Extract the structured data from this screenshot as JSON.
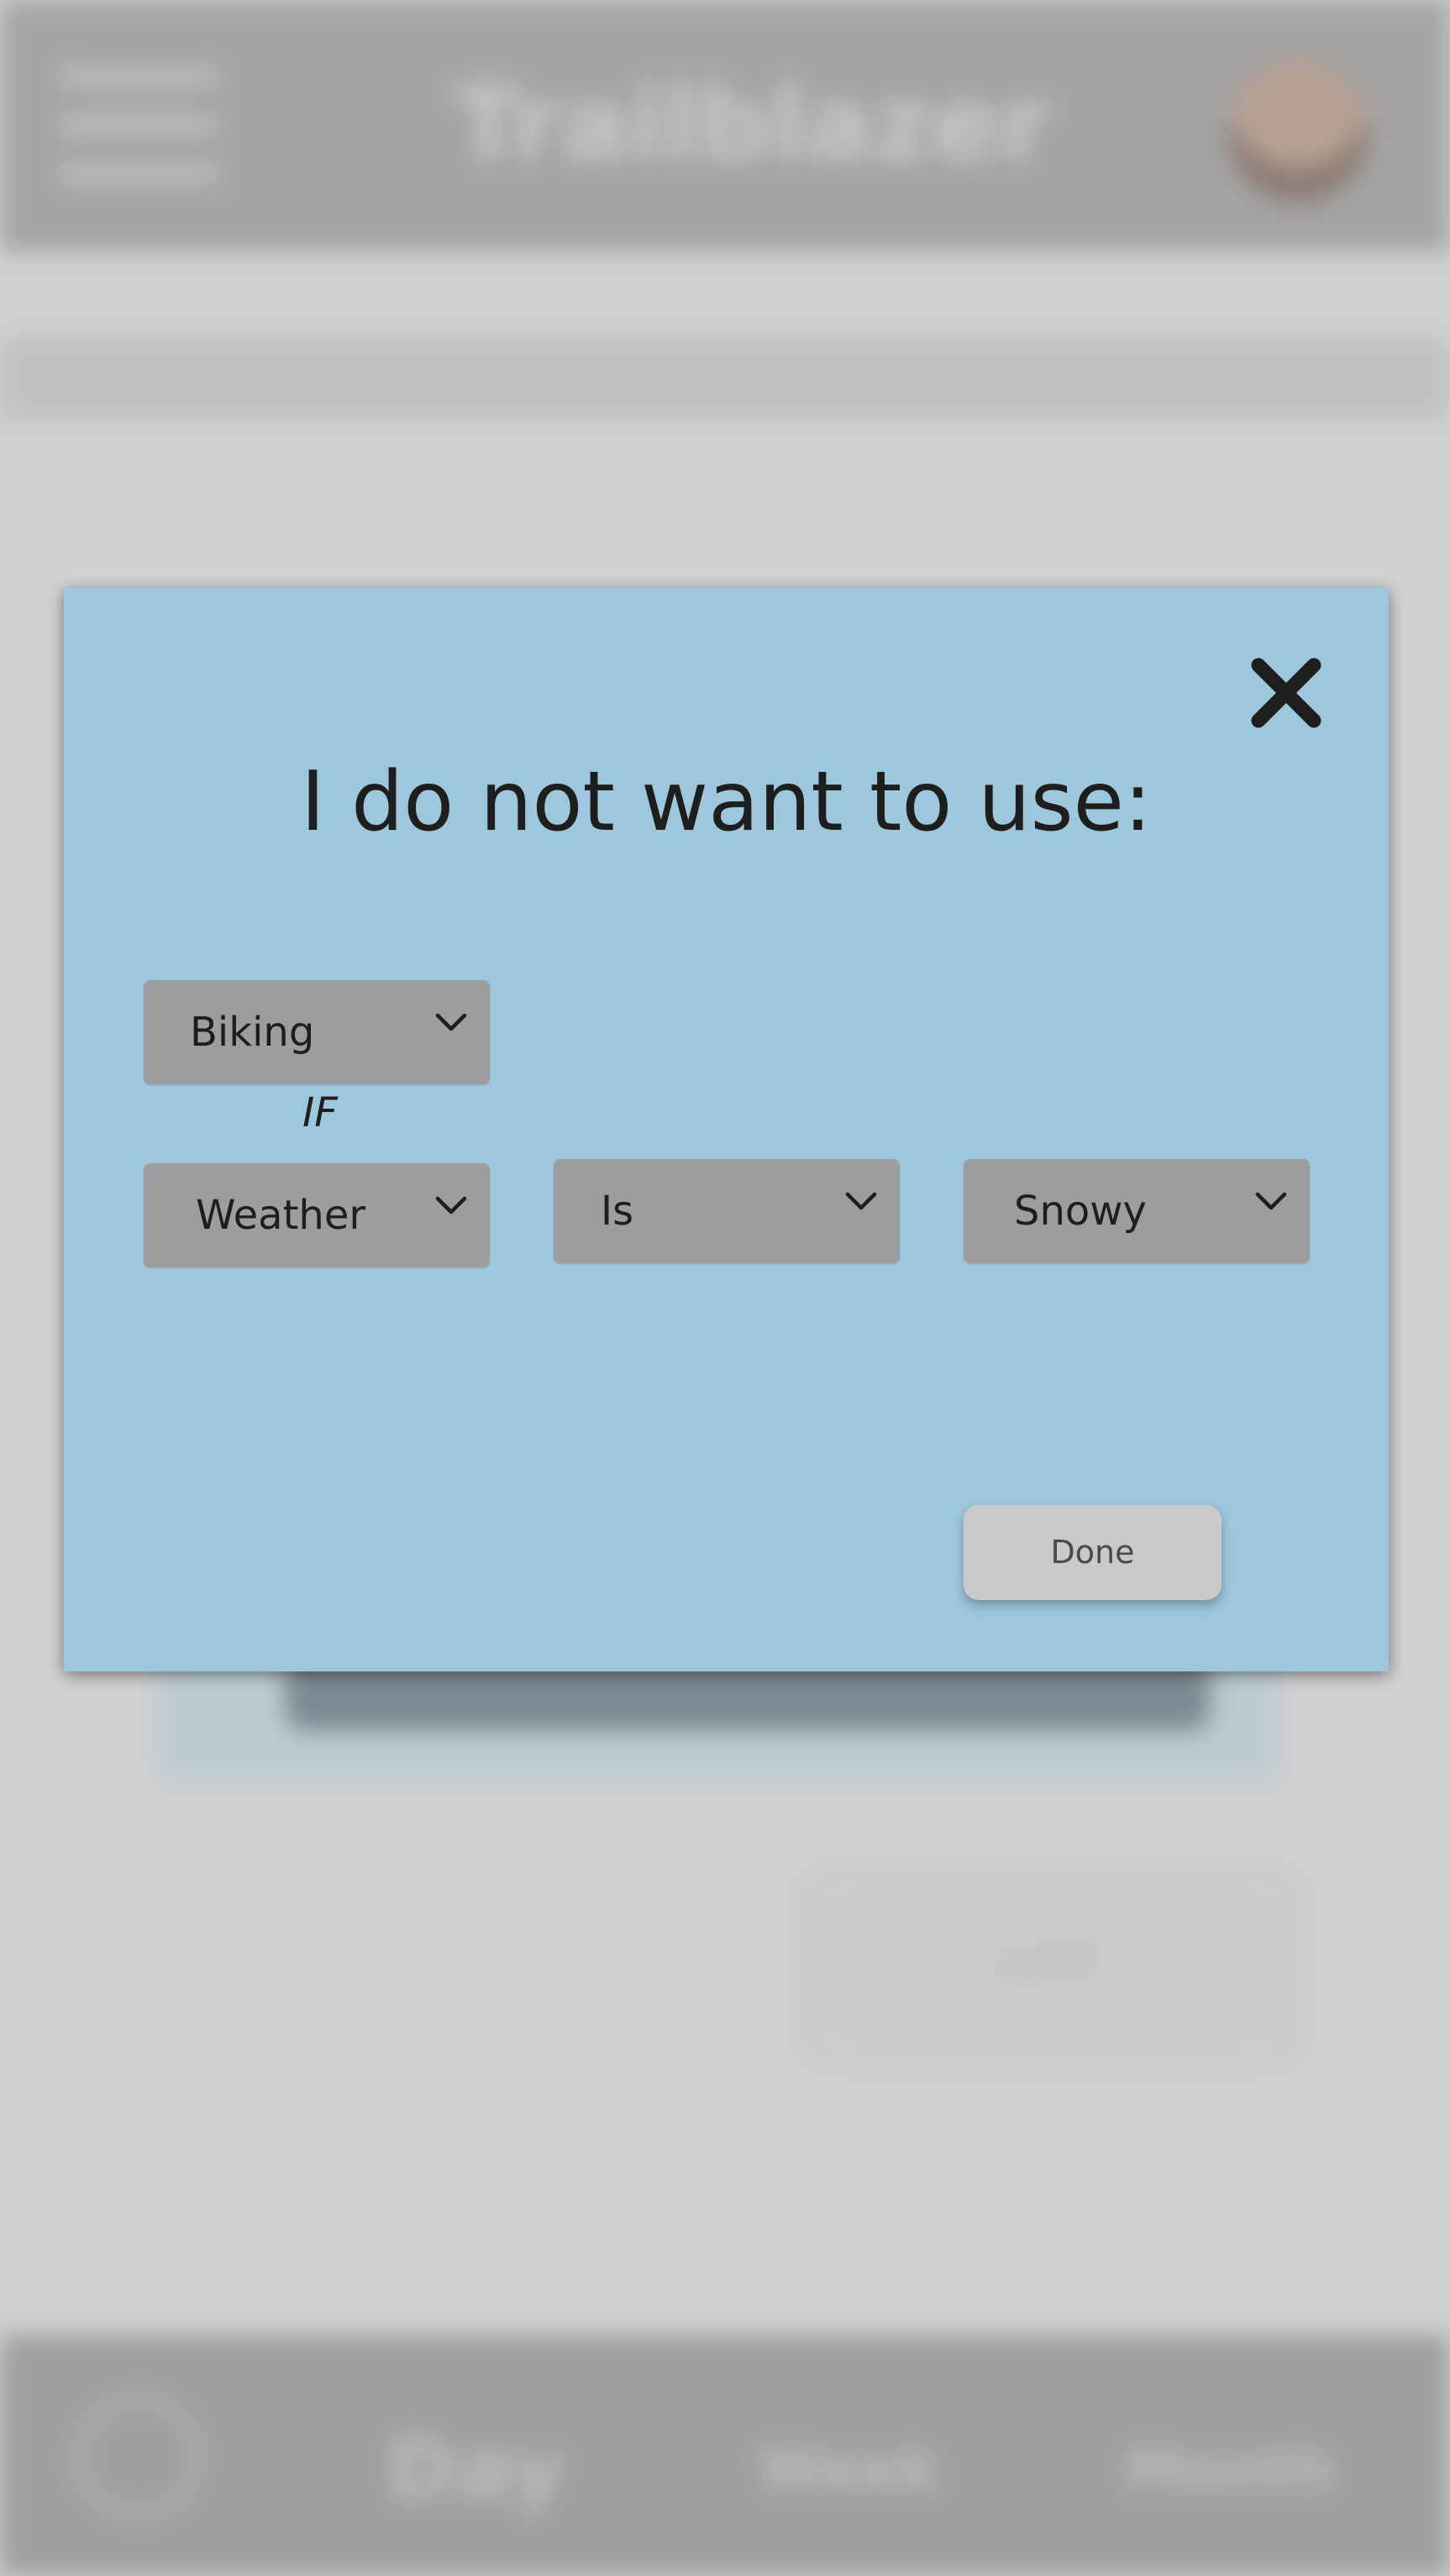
{
  "background": {
    "app_title": "Trailblazer",
    "add_button_label": "add",
    "footer_tabs": [
      {
        "label": "Day"
      },
      {
        "label": "Week"
      },
      {
        "label": "Month"
      }
    ]
  },
  "modal": {
    "title": "I do not want to use:",
    "close_icon": "close-icon",
    "activity_select": {
      "value": "Biking",
      "icon": "chevron-down-icon"
    },
    "if_label": "IF",
    "condition_select": {
      "value": "Weather",
      "icon": "chevron-down-icon"
    },
    "operator_select": {
      "value": "Is",
      "icon": "chevron-down-icon"
    },
    "value_select": {
      "value": "Snowy",
      "icon": "chevron-down-icon"
    },
    "done_label": "Done"
  },
  "colors": {
    "modal_background": "#9dc7dc",
    "dropdown_background": "#9d9d9f",
    "done_button_background": "#c9c9c9",
    "header_background": "#a9a9a9",
    "footer_background": "#a3a3a3"
  }
}
